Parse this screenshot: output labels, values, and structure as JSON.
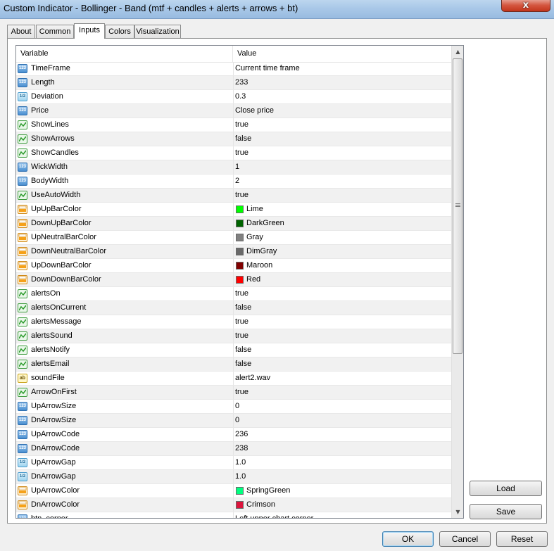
{
  "window": {
    "title": "Custom Indicator - Bollinger - Band (mtf + candles + alerts + arrows + bt)",
    "close_glyph": "x"
  },
  "tabs": [
    {
      "label": "About"
    },
    {
      "label": "Common"
    },
    {
      "label": "Inputs",
      "active": true
    },
    {
      "label": "Colors"
    },
    {
      "label": "Visualization"
    }
  ],
  "grid": {
    "col_variable": "Variable",
    "col_value": "Value",
    "rows": [
      {
        "type": "int",
        "name": "TimeFrame",
        "value": "Current time frame"
      },
      {
        "type": "int",
        "name": "Length",
        "value": "233"
      },
      {
        "type": "double",
        "name": "Deviation",
        "value": "0.3"
      },
      {
        "type": "int",
        "name": "Price",
        "value": "Close price"
      },
      {
        "type": "bool",
        "name": "ShowLines",
        "value": "true"
      },
      {
        "type": "bool",
        "name": "ShowArrows",
        "value": "false"
      },
      {
        "type": "bool",
        "name": "ShowCandles",
        "value": "true"
      },
      {
        "type": "int",
        "name": "WickWidth",
        "value": "1"
      },
      {
        "type": "int",
        "name": "BodyWidth",
        "value": "2"
      },
      {
        "type": "bool",
        "name": "UseAutoWidth",
        "value": "true"
      },
      {
        "type": "color",
        "name": "UpUpBarColor",
        "value": "Lime",
        "swatch": "#00ff00"
      },
      {
        "type": "color",
        "name": "DownUpBarColor",
        "value": "DarkGreen",
        "swatch": "#006400"
      },
      {
        "type": "color",
        "name": "UpNeutralBarColor",
        "value": "Gray",
        "swatch": "#808080"
      },
      {
        "type": "color",
        "name": "DownNeutralBarColor",
        "value": "DimGray",
        "swatch": "#696969"
      },
      {
        "type": "color",
        "name": "UpDownBarColor",
        "value": "Maroon",
        "swatch": "#800000"
      },
      {
        "type": "color",
        "name": "DownDownBarColor",
        "value": "Red",
        "swatch": "#ff0000"
      },
      {
        "type": "bool",
        "name": "alertsOn",
        "value": "true"
      },
      {
        "type": "bool",
        "name": "alertsOnCurrent",
        "value": "false"
      },
      {
        "type": "bool",
        "name": "alertsMessage",
        "value": "true"
      },
      {
        "type": "bool",
        "name": "alertsSound",
        "value": "true"
      },
      {
        "type": "bool",
        "name": "alertsNotify",
        "value": "false"
      },
      {
        "type": "bool",
        "name": "alertsEmail",
        "value": "false"
      },
      {
        "type": "string",
        "name": "soundFile",
        "value": "alert2.wav"
      },
      {
        "type": "bool",
        "name": "ArrowOnFirst",
        "value": "true"
      },
      {
        "type": "int",
        "name": "UpArrowSize",
        "value": "0"
      },
      {
        "type": "int",
        "name": "DnArrowSize",
        "value": "0"
      },
      {
        "type": "int",
        "name": "UpArrowCode",
        "value": "236"
      },
      {
        "type": "int",
        "name": "DnArrowCode",
        "value": "238"
      },
      {
        "type": "double",
        "name": "UpArrowGap",
        "value": "1.0"
      },
      {
        "type": "double",
        "name": "DnArrowGap",
        "value": "1.0"
      },
      {
        "type": "color",
        "name": "UpArrowColor",
        "value": "SpringGreen",
        "swatch": "#00ff7f"
      },
      {
        "type": "color",
        "name": "DnArrowColor",
        "value": "Crimson",
        "swatch": "#dc143c"
      },
      {
        "type": "int",
        "name": "btn_corner",
        "value": "Left upper chart corner"
      }
    ]
  },
  "icon_glyphs": {
    "int": "123",
    "double": "1/2",
    "string": "ab"
  },
  "buttons": {
    "load": "Load",
    "save": "Save",
    "ok": "OK",
    "cancel": "Cancel",
    "reset": "Reset"
  }
}
